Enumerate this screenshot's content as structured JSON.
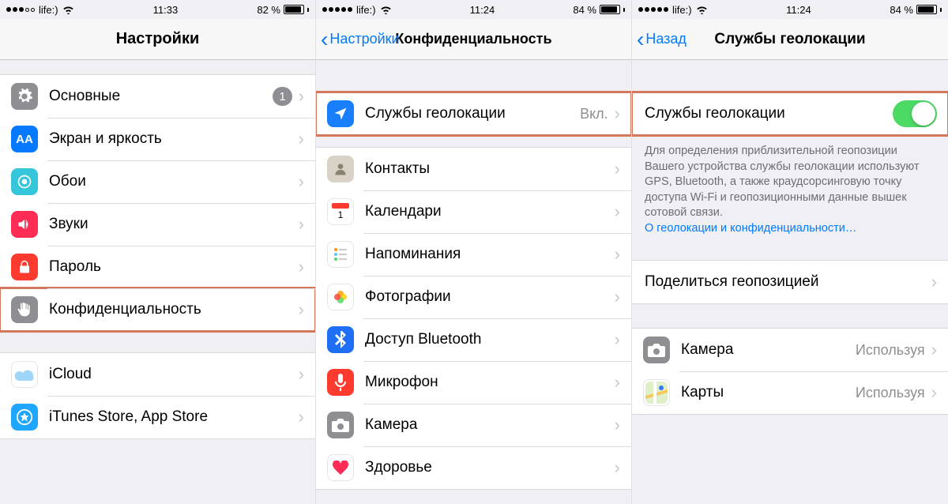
{
  "panel1": {
    "status": {
      "carrier": "life:)",
      "time": "11:33",
      "battery_pct": "82 %",
      "battery_fill": 82
    },
    "nav": {
      "title": "Настройки"
    },
    "group1": [
      {
        "key": "general",
        "label": "Основные",
        "badge": "1"
      },
      {
        "key": "display",
        "label": "Экран и яркость"
      },
      {
        "key": "wall",
        "label": "Обои"
      },
      {
        "key": "sounds",
        "label": "Звуки"
      },
      {
        "key": "passcode",
        "label": "Пароль"
      },
      {
        "key": "privacy",
        "label": "Конфиденциальность",
        "highlight": true
      }
    ],
    "group2": [
      {
        "key": "icloud",
        "label": "iCloud"
      },
      {
        "key": "itunes",
        "label": "iTunes Store, App Store"
      }
    ]
  },
  "panel2": {
    "status": {
      "carrier": "life:)",
      "time": "11:24",
      "battery_pct": "84 %",
      "battery_fill": 84
    },
    "nav": {
      "back": "Настройки",
      "title": "Конфиденциальность"
    },
    "group1": [
      {
        "key": "location",
        "label": "Службы геолокации",
        "detail": "Вкл.",
        "highlight": true
      }
    ],
    "group2": [
      {
        "key": "contacts",
        "label": "Контакты"
      },
      {
        "key": "calendar",
        "label": "Календари"
      },
      {
        "key": "reminder",
        "label": "Напоминания"
      },
      {
        "key": "photos",
        "label": "Фотографии"
      },
      {
        "key": "bt",
        "label": "Доступ Bluetooth"
      },
      {
        "key": "mic",
        "label": "Микрофон"
      },
      {
        "key": "camera",
        "label": "Камера"
      },
      {
        "key": "health",
        "label": "Здоровье"
      }
    ]
  },
  "panel3": {
    "status": {
      "carrier": "life:)",
      "time": "11:24",
      "battery_pct": "84 %",
      "battery_fill": 84
    },
    "nav": {
      "back": "Назад",
      "title": "Службы геолокации"
    },
    "toggle": {
      "label": "Службы геолокации",
      "on": true,
      "highlight": true
    },
    "note_text": "Для определения приблизительной геопозиции Вашего устройства службы геолокации используют GPS, Bluetooth, а также краудсорсинговую точку доступа Wi-Fi и геопозиционными данные вышек сотовой связи.",
    "note_link": "О геолокации и конфиденциальности…",
    "share": {
      "label": "Поделиться геопозицией"
    },
    "apps": [
      {
        "key": "camera",
        "label": "Камера",
        "detail": "Используя"
      },
      {
        "key": "maps",
        "label": "Карты",
        "detail": "Используя"
      }
    ]
  }
}
